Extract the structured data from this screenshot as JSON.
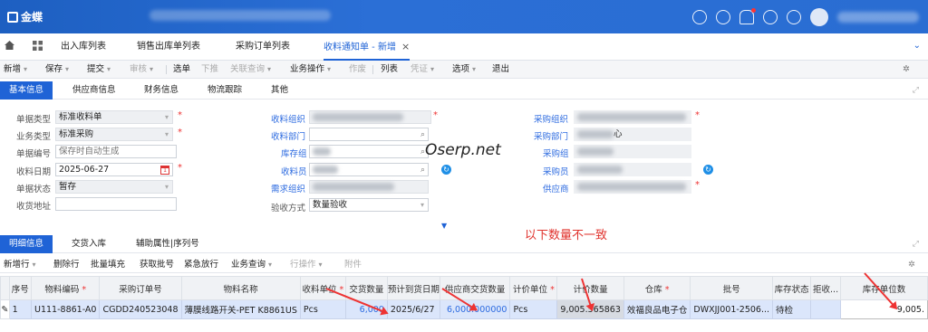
{
  "app": {
    "logo_text": "金蝶"
  },
  "tabs": [
    {
      "label": "出入库列表"
    },
    {
      "label": "销售出库单列表"
    },
    {
      "label": "采购订单列表"
    },
    {
      "label": "收料通知单 - 新增",
      "close": "×"
    }
  ],
  "toolbar": [
    "新增",
    "保存",
    "提交",
    "审核",
    "选单",
    "下推",
    "关联查询",
    "业务操作",
    "作废",
    "列表",
    "凭证",
    "选项",
    "退出"
  ],
  "form_tabs": [
    "基本信息",
    "供应商信息",
    "财务信息",
    "物流跟踪",
    "其他"
  ],
  "form": {
    "bill_type": {
      "label": "单据类型",
      "value": "标准收料单"
    },
    "biz_type": {
      "label": "业务类型",
      "value": "标准采购"
    },
    "bill_no": {
      "label": "单据编号",
      "placeholder": "保存时自动生成"
    },
    "receive_date": {
      "label": "收料日期",
      "value": "2025-06-27"
    },
    "bill_status": {
      "label": "单据状态",
      "value": "暂存"
    },
    "receive_addr": {
      "label": "收货地址",
      "value": ""
    },
    "receive_org": {
      "label": "收料组织"
    },
    "receive_dept": {
      "label": "收料部门"
    },
    "stock_group": {
      "label": "库存组"
    },
    "receiver": {
      "label": "收料员"
    },
    "demand_org": {
      "label": "需求组织"
    },
    "inspect_method": {
      "label": "验收方式",
      "value": "数量验收"
    },
    "purchase_org": {
      "label": "采购组织"
    },
    "purchase_dept": {
      "label": "采购部门",
      "value_suffix": "心"
    },
    "purchase_group": {
      "label": "采购组"
    },
    "purchaser": {
      "label": "采购员"
    },
    "supplier": {
      "label": "供应商"
    }
  },
  "watermark": "Oserp.net",
  "annotation_note": "以下数量不一致",
  "detail_tabs": [
    "明细信息",
    "交货入库",
    "辅助属性|序列号"
  ],
  "detail_toolbar": [
    "新增行",
    "删除行",
    "批量填充",
    "获取批号",
    "紧急放行",
    "业务查询",
    "行操作",
    "附件"
  ],
  "grid": {
    "headers": [
      "序号",
      "物料编码",
      "采购订单号",
      "物料名称",
      "收料单位",
      "交货数量",
      "预计到货日期",
      "供应商交货数量",
      "计价单位",
      "计价数量",
      "仓库",
      "批号",
      "库存状态",
      "拒收...",
      "库存单位数"
    ],
    "rows": [
      [
        "1",
        "U111-8861-A0",
        "CGDD240523048",
        "薄膜线路开关-PET K8861US",
        "Pcs",
        "6,000",
        "2025/6/27",
        "6,000.000000",
        "Pcs",
        "9,005.565863",
        "效福良品电子仓",
        "DWXJJ001-2506...",
        "待检",
        "",
        "9,005."
      ]
    ]
  },
  "colors": {
    "primary": "#1f63d6",
    "annotation": "#e33"
  }
}
